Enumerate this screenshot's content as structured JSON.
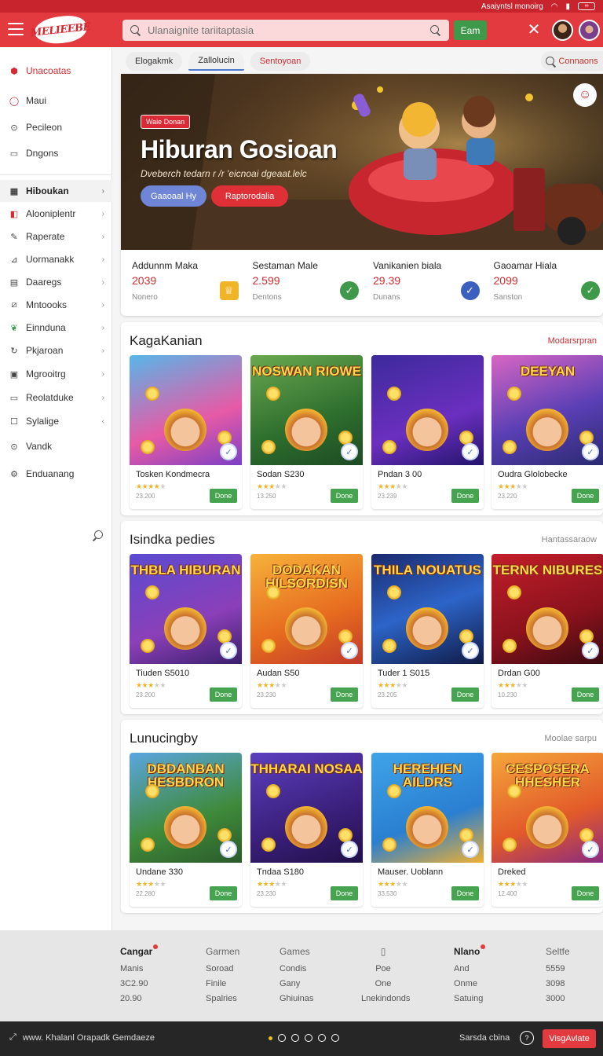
{
  "status_bar": {
    "text": "Asaiyntsl monoirg",
    "icons": [
      "wifi-icon",
      "signal-icon",
      "battery-icon"
    ],
    "battery": "∞"
  },
  "header": {
    "logo": "MELIEEBE",
    "search": {
      "placeholder": "Ulanaignite tariitaptasia"
    },
    "search_button": "Eam",
    "accent": "#e23a3f"
  },
  "sidebar": {
    "title": "Unacoatas",
    "items_top": [
      {
        "label": "Maui",
        "icon": "pin-icon"
      },
      {
        "label": "Pecileon",
        "icon": "circle-icon"
      },
      {
        "label": "Dngons",
        "icon": "box-icon"
      }
    ],
    "items_main": [
      {
        "label": "Hiboukan",
        "icon": "grid-icon",
        "active": true,
        "chev": "›"
      },
      {
        "label": "Alooniplentr",
        "icon": "bookmark-icon",
        "chev": "›"
      },
      {
        "label": "Raperate",
        "icon": "edit-icon",
        "chev": "›"
      },
      {
        "label": "Uormanakk",
        "icon": "chart-icon",
        "chev": "›"
      },
      {
        "label": "Daaregs",
        "icon": "calendar-icon",
        "chev": "›"
      },
      {
        "label": "Mntoooks",
        "icon": "slash-box-icon",
        "chev": "›"
      },
      {
        "label": "Einnduna",
        "icon": "leaf-icon",
        "chev": "›"
      },
      {
        "label": "Pkjaroan",
        "icon": "cycle-icon",
        "chev": "›"
      },
      {
        "label": "Mgrooitrg",
        "icon": "message-icon",
        "chev": "›"
      },
      {
        "label": "Reolatduke",
        "icon": "panel-icon",
        "chev": "›"
      },
      {
        "label": "Sylalige",
        "icon": "square-icon",
        "chev": "‹"
      },
      {
        "label": "Vandk",
        "icon": "compass-icon"
      },
      {
        "label": "Enduanang",
        "icon": "settings-icon"
      }
    ]
  },
  "tabs": [
    {
      "label": "Elogakmk"
    },
    {
      "label": "Zallolucin",
      "active": true
    },
    {
      "label": "Sentoyoan",
      "hot": true
    }
  ],
  "compare_button": "Connaons",
  "hero": {
    "tag": "Waie Donan",
    "title": "Hiburan Gosioan",
    "subtitle": "Dveberch tedarn r /r 'eicnoai dgeaat.lelc",
    "btn_primary": "Gaaoaal Hy",
    "btn_secondary": "Raptorodalia"
  },
  "stats": [
    {
      "label": "Addunnm Maka",
      "value": "2039",
      "sub": "Nonero",
      "icon": "trophy-icon",
      "color": "#f0b429"
    },
    {
      "label": "Sestaman Male",
      "value": "2.599",
      "sub": "Dentons",
      "icon": "check-icon",
      "color": "#3e9a4a"
    },
    {
      "label": "Vanikanien biala",
      "value": "29.39",
      "sub": "Dunans",
      "icon": "check-icon",
      "color": "#3b5fbf"
    },
    {
      "label": "Gaoamar Hiala",
      "value": "2099",
      "sub": "Sanston",
      "icon": "check-icon",
      "color": "#3e9a4a"
    }
  ],
  "sections": [
    {
      "title": "KagaKanian",
      "link": "Modarsrpran",
      "link_style": "red",
      "cards": [
        {
          "title": "Tosken Kondmecra",
          "num": "23.200",
          "rating": 4,
          "button": "Done",
          "thumb": "",
          "bg": "linear-gradient(160deg,#57b6e8,#e75aa6 60%,#7b3fc4)"
        },
        {
          "title": "Sodan S230",
          "num": "13.250",
          "rating": 3,
          "button": "Done",
          "thumb": "NOSWAN RIOWE",
          "bg": "linear-gradient(160deg,#6aa84f,#2d6e2e 60%,#1d4a22)"
        },
        {
          "title": "Pndan 3 00",
          "num": "23.239",
          "rating": 3,
          "button": "Done",
          "thumb": "",
          "bg": "linear-gradient(160deg,#3c2a9c,#6b2fbf 60%,#22146b)"
        },
        {
          "title": "Oudra Glolobecke",
          "num": "23.220",
          "rating": 3,
          "button": "Done",
          "thumb": "DEEYAN",
          "bg": "linear-gradient(160deg,#d866c3,#5a3fb5 55%,#2a2a70)"
        }
      ]
    },
    {
      "title": "Isindka pedies",
      "link": "Hantassaraow",
      "link_style": "gray",
      "cards": [
        {
          "title": "Tiuden S5010",
          "num": "23.200",
          "rating": 3,
          "button": "Done",
          "thumb": "THBLA HIBURAN",
          "bg": "linear-gradient(160deg,#5a4bd1,#8b3fb8 60%,#3a1f6b)"
        },
        {
          "title": "Audan S50",
          "num": "23.230",
          "rating": 3,
          "button": "Done",
          "thumb": "DODAKAN HILSORDISN",
          "bg": "linear-gradient(160deg,#f7b23a,#e66a1f 60%,#c13a2a)"
        },
        {
          "title": "Tuder 1 S015",
          "num": "23.205",
          "rating": 3,
          "button": "Done",
          "thumb": "THILA NOUATUS",
          "bg": "linear-gradient(160deg,#1b2a6e,#2d64c8 50%,#0f1a45)"
        },
        {
          "title": "Drdan G00",
          "num": "10.230",
          "rating": 3,
          "button": "Done",
          "thumb": "TERNK NIBURES",
          "bg": "linear-gradient(160deg,#c21e2a,#8a121c 60%,#3b0a10)"
        }
      ]
    },
    {
      "title": "Lunucingby",
      "link": "Moolae sarpu",
      "link_style": "gray",
      "cards": [
        {
          "title": "Undane 330",
          "num": "22.280",
          "rating": 3,
          "button": "Done",
          "thumb": "DBDANBAN HESBDRON",
          "bg": "linear-gradient(160deg,#5aa6e0,#3f8a3a 60%,#2b5a2b)"
        },
        {
          "title": "Tndaa S180",
          "num": "23.230",
          "rating": 3,
          "button": "Done",
          "thumb": "THHARAI NOSAA",
          "bg": "linear-gradient(160deg,#5b3fbf,#3a1f7a 60%,#201048)"
        },
        {
          "title": "Mauser. Uoblann",
          "num": "33.530",
          "rating": 3,
          "button": "Done",
          "thumb": "HEREHIEN AILDRS",
          "bg": "linear-gradient(160deg,#3fa4e8,#2a7fd1 60%,#f0b030)"
        },
        {
          "title": "Dreked",
          "num": "12.400",
          "rating": 3,
          "button": "Done",
          "thumb": "CESPOSERA HHESHER",
          "bg": "linear-gradient(160deg,#f5a63a,#e25a2a 60%,#8b2a80)"
        }
      ]
    }
  ],
  "footer": {
    "columns": [
      {
        "head": "Cangar",
        "dot": true,
        "items": [
          "Manis",
          "3C2.90",
          "20.90"
        ]
      },
      {
        "head": "Garmen",
        "items": [
          "Soroad",
          "Finile",
          "Spalries"
        ]
      },
      {
        "head": "Games",
        "items": [
          "Condis",
          "Gany",
          "Ghiuinas"
        ]
      },
      {
        "head": "",
        "icon": "doc-icon",
        "items": [
          "Poe",
          "One",
          "Lnekindonds"
        ]
      },
      {
        "head": "Nlano",
        "dot": true,
        "items": [
          "And",
          "Onme",
          "Satuing"
        ]
      },
      {
        "head": "Seltfe",
        "items": [
          "5559",
          "3098",
          "3000"
        ]
      }
    ]
  },
  "bottom_bar": {
    "left_text": "www. Khalanl Orapadk Gemdaeze",
    "right_text": "Sarsda cbina",
    "button": "VisgAvlate"
  }
}
